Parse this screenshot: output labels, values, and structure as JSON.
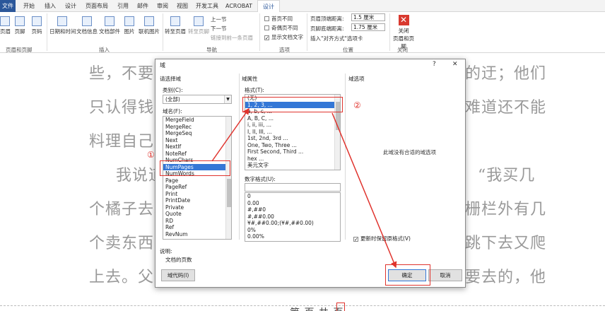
{
  "ribbon": {
    "tabs": [
      "文件",
      "开始",
      "插入",
      "设计",
      "页面布局",
      "引用",
      "邮件",
      "审阅",
      "视图",
      "开发工具",
      "ACROBAT",
      "设计"
    ],
    "buttons": {
      "header_cut": "页眉",
      "footer": "页脚",
      "page_number": "页码",
      "date_time": "日期和时间",
      "doc_info": "文档信息",
      "doc_parts": "文档部件",
      "picture": "图片",
      "online_picture": "联机图片",
      "goto_header": "转至页眉",
      "goto_footer": "转至页脚",
      "prev": "上一节",
      "next": "下一节",
      "link_prev": "链接到前一条页眉",
      "first_diff": "首页不同",
      "odd_even_diff": "奇偶页不同",
      "show_doc_text": "显示文档文字",
      "header_top_label": "页眉顶端距离:",
      "header_top_value": "1.5 厘米",
      "footer_bottom_label": "页脚底端距离:",
      "footer_bottom_value": "1.75 厘米",
      "insert_align_tab": "插入\"对齐方式\"选项卡",
      "close_label_1": "关闭",
      "close_label_2": "页眉和页脚"
    },
    "groups": [
      "页眉和页脚",
      "插入",
      "导航",
      "选项",
      "位置",
      "关闭"
    ]
  },
  "document": {
    "lines": [
      "些，不要受",
      "只认得钱，",
      "料理自己么",
      "我说道",
      "个橘子去。",
      "个卖东西的",
      "上去。父亲"
    ],
    "right_fragments": [
      "的迂；他们",
      "难道还不能",
      "“我买几",
      "栅栏外有几",
      "跳下去又爬",
      "要去的，他"
    ],
    "footer_text": "第 页 共 页"
  },
  "dialog": {
    "title": "域",
    "help": "?",
    "close": "✕",
    "select_field": "请选择域",
    "category_label": "类别(C):",
    "category_value": "(全部)",
    "field_names_label": "域名(F):",
    "field_names": [
      "MergeField",
      "MergeRec",
      "MergeSeq",
      "Next",
      "NextIf",
      "NoteRef",
      "NumChars",
      "NumPages",
      "NumWords",
      "Page",
      "PageRef",
      "Print",
      "PrintDate",
      "Private",
      "Quote",
      "RD",
      "Ref",
      "RevNum"
    ],
    "selected_field": "NumPages",
    "field_props": "域属性",
    "format_label": "格式(T):",
    "formats": [
      "(无)",
      "1, 2, 3, ...",
      "a, b, c, ...",
      "A, B, C, ...",
      "i, ii, iii, ...",
      "I, II, III, ...",
      "1st, 2nd, 3rd ...",
      "One, Two, Three ...",
      "First Second, Third ...",
      "hex ...",
      "美元文字"
    ],
    "selected_format": "1, 2, 3, ...",
    "number_format_label": "数字格式(U):",
    "number_formats": [
      "0",
      "0.00",
      "#,##0",
      "#,##0.00",
      "¥#,##0.00;(¥#,##0.00)",
      "0%",
      "0.00%"
    ],
    "field_options": "域选项",
    "no_options": "此域没有合适的域选项",
    "preserve_format": "更新时保留原格式(V)",
    "description_label": "说明:",
    "description": "文档的页数",
    "field_codes_button": "域代码(I)",
    "ok_button": "确定",
    "cancel_button": "取消"
  },
  "annotations": {
    "marker_1": "①",
    "marker_2": "②",
    "color": "#e0332d"
  }
}
